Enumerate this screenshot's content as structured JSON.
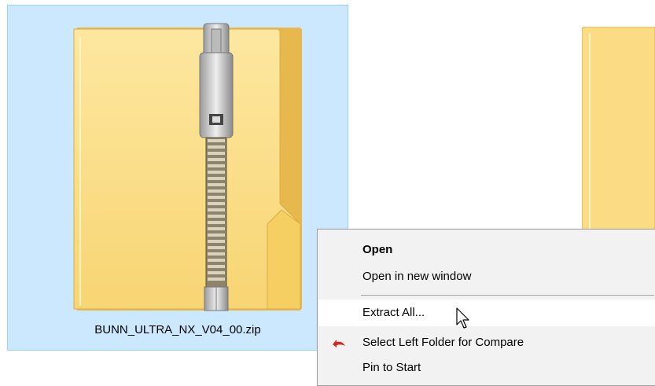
{
  "file": {
    "name": "BUNN_ULTRA_NX_V04_00.zip",
    "icon": "zip-folder-icon"
  },
  "context_menu": {
    "items": [
      {
        "label": "Open",
        "bold": true
      },
      {
        "label": "Open in new window"
      },
      {
        "label": "Extract All...",
        "hovered": true
      },
      {
        "label": "Select Left Folder for Compare",
        "icon": "compare-arrow-icon"
      },
      {
        "label": "Pin to Start"
      }
    ]
  },
  "colors": {
    "selection_bg": "#cce8ff",
    "selection_border": "#99d1ff",
    "menu_bg": "#f2f2f2",
    "folder": "#fbd774",
    "compare_icon": "#d32a1c"
  }
}
